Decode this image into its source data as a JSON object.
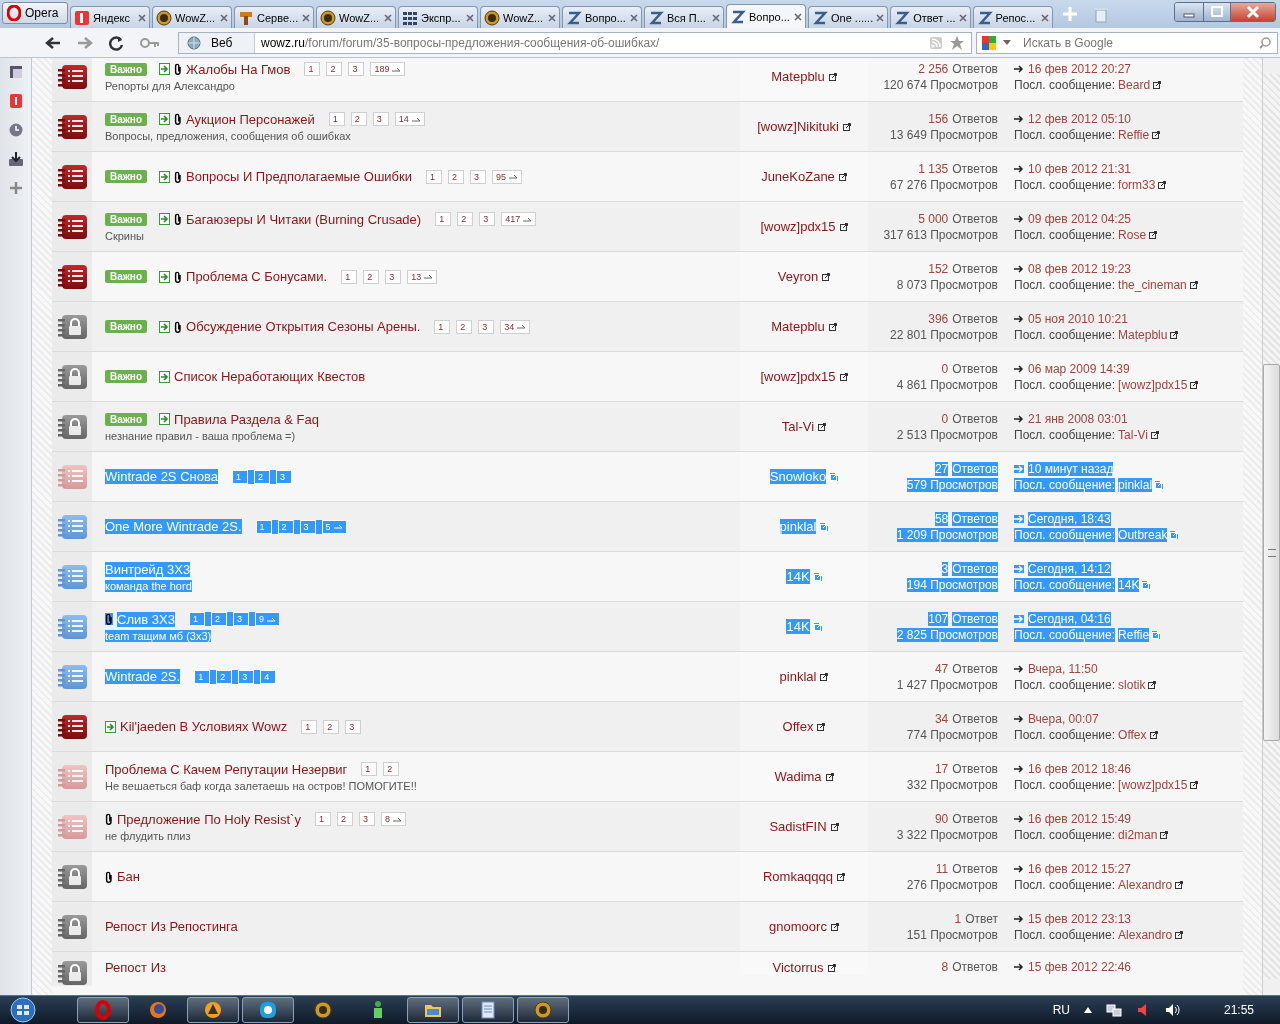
{
  "browser": {
    "menu_label": "Opera",
    "tabs": [
      {
        "title": "Яндекс",
        "kind": "square",
        "selected": false
      },
      {
        "title": "WowZ...",
        "kind": "coin",
        "selected": false
      },
      {
        "title": "Серве...",
        "kind": "hammer",
        "selected": false
      },
      {
        "title": "WowZ...",
        "kind": "coin",
        "selected": false
      },
      {
        "title": "Экспр...",
        "kind": "grid",
        "selected": false
      },
      {
        "title": "WowZ...",
        "kind": "coin",
        "selected": false
      },
      {
        "title": "Вопро...",
        "kind": "zigzag",
        "selected": false
      },
      {
        "title": "Вся П...",
        "kind": "zigzag",
        "selected": false
      },
      {
        "title": "Вопро...",
        "kind": "zigzag",
        "selected": true
      },
      {
        "title": "One ......",
        "kind": "zigzag",
        "selected": false
      },
      {
        "title": "Ответ ...",
        "kind": "zigzag",
        "selected": false
      },
      {
        "title": "Репос...",
        "kind": "zigzag",
        "selected": false
      }
    ],
    "address": {
      "scope": "Веб",
      "host": "wowz.ru",
      "path": "/forum/forum/35-вопросы-предложения-сообщения-об-ошибках/"
    },
    "search": {
      "placeholder": "Искать в Google"
    }
  },
  "topics": [
    {
      "kind": "hot",
      "badge": "Важно",
      "new": true,
      "attachment": true,
      "title": "Жалобы На Гмов",
      "subtitle": "Репорты для Александро",
      "pages": [
        "1",
        "2",
        "3"
      ],
      "last_page": "189",
      "author": "Matepblu",
      "replies": "2 256",
      "replies_word": "Ответов",
      "views": "120 674 Просмотров",
      "last_time": "16 фев 2012 20:27",
      "last_label": "Посл. сообщение:",
      "last_by": "Beard",
      "title_selected": false,
      "selected": false
    },
    {
      "kind": "hot",
      "badge": "Важно",
      "new": true,
      "attachment": true,
      "title": "Аукцион Персонажей",
      "subtitle": "Вопросы, предложения, сообщения об ошибках",
      "pages": [
        "1",
        "2",
        "3"
      ],
      "last_page": "14",
      "author": "[wowz]Nikituki",
      "replies": "156",
      "replies_word": "Ответов",
      "views": "13 649 Просмотров",
      "last_time": "12 фев 2012 05:10",
      "last_label": "Посл. сообщение:",
      "last_by": "Reffie",
      "title_selected": false,
      "selected": false
    },
    {
      "kind": "hot",
      "badge": "Важно",
      "new": true,
      "attachment": true,
      "title": "Вопросы И Предполагаемые Ошибки",
      "pages": [
        "1",
        "2",
        "3"
      ],
      "last_page": "95",
      "author": "JuneKoZane",
      "replies": "1 135",
      "replies_word": "Ответов",
      "views": "67 276 Просмотров",
      "last_time": "10 фев 2012 21:31",
      "last_label": "Посл. сообщение:",
      "last_by": "form33",
      "title_selected": false,
      "selected": false
    },
    {
      "kind": "hot",
      "badge": "Важно",
      "new": true,
      "attachment": true,
      "title": "Багаюзеры И Читаки (Burning Crusade)",
      "subtitle": "Скрины",
      "pages": [
        "1",
        "2",
        "3"
      ],
      "last_page": "417",
      "author": "[wowz]pdx15",
      "replies": "5 000",
      "replies_word": "Ответов",
      "views": "317 613 Просмотров",
      "last_time": "09 фев 2012 04:25",
      "last_label": "Посл. сообщение:",
      "last_by": "Rose",
      "title_selected": false,
      "selected": false
    },
    {
      "kind": "hot",
      "badge": "Важно",
      "new": true,
      "attachment": true,
      "title": "Проблема С Бонусами.",
      "pages": [
        "1",
        "2",
        "3"
      ],
      "last_page": "13",
      "author": "Veyron",
      "replies": "152",
      "replies_word": "Ответов",
      "views": "8 073 Просмотров",
      "last_time": "08 фев 2012 19:23",
      "last_label": "Посл. сообщение:",
      "last_by": "the_cineman",
      "title_selected": false,
      "selected": false
    },
    {
      "kind": "locked",
      "badge": "Важно",
      "new": true,
      "attachment": true,
      "title": "Обсуждение Открытия Сезоны Арены.",
      "pages": [
        "1",
        "2",
        "3"
      ],
      "last_page": "34",
      "author": "Matepblu",
      "replies": "396",
      "replies_word": "Ответов",
      "views": "22 801 Просмотров",
      "last_time": "05 ноя 2010 10:21",
      "last_label": "Посл. сообщение:",
      "last_by": "Matepblu",
      "title_selected": false,
      "selected": false
    },
    {
      "kind": "locked",
      "badge": "Важно",
      "new": true,
      "attachment": false,
      "title": "Список Неработающих Квестов",
      "author": "[wowz]pdx15",
      "replies": "0",
      "replies_word": "Ответов",
      "views": "4 861 Просмотров",
      "last_time": "06 мар 2009 14:39",
      "last_label": "Посл. сообщение:",
      "last_by": "[wowz]pdx15",
      "title_selected": false,
      "selected": false
    },
    {
      "kind": "locked",
      "badge": "Важно",
      "new": true,
      "attachment": false,
      "title": "Правила Раздела & Faq",
      "subtitle": "незнание правил - ваша проблема =)",
      "author": "Tal-Vi",
      "replies": "0",
      "replies_word": "Ответов",
      "views": "2 513 Просмотров",
      "last_time": "21 янв 2008 03:01",
      "last_label": "Посл. сообщение:",
      "last_by": "Tal-Vi",
      "title_selected": false,
      "selected": false
    },
    {
      "kind": "read",
      "new": false,
      "attachment": false,
      "title": "Wintrade 2S Снова",
      "pages": [
        "1",
        "2",
        "3"
      ],
      "author": "Snowloko",
      "replies": "27",
      "replies_word": "Ответов",
      "views": "579 Просмотров",
      "last_time": "10 минут назад",
      "last_label": "Посл. сообщение:",
      "last_by": "pinklal",
      "title_selected": true,
      "selected": true
    },
    {
      "kind": "highlighted",
      "new": false,
      "attachment": false,
      "title": "One More Wintrade 2S.",
      "pages": [
        "1",
        "2",
        "3"
      ],
      "last_page": "5",
      "author": "pinklal",
      "replies": "58",
      "replies_word": "Ответов",
      "views": "1 209 Просмотров",
      "last_time": "Сегодня, 18:43",
      "last_label": "Посл. сообщение:",
      "last_by": "Outbreak",
      "title_selected": true,
      "selected": true
    },
    {
      "kind": "highlighted",
      "new": false,
      "attachment": false,
      "title": "Винтрейд 3X3",
      "subtitle": "команда the hord",
      "author": "14K",
      "replies": "3",
      "replies_word": "Ответов",
      "views": "194 Просмотров",
      "last_time": "Сегодня, 14:12",
      "last_label": "Посл. сообщение:",
      "last_by": "14K",
      "title_selected": true,
      "selected": true
    },
    {
      "kind": "highlighted",
      "new": false,
      "attachment": true,
      "title": "Слив 3X3",
      "subtitle": "team тащим мб (3x3)",
      "pages": [
        "1",
        "2",
        "3"
      ],
      "last_page": "9",
      "author": "14K",
      "replies": "107",
      "replies_word": "Ответов",
      "views": "2 825 Просмотров",
      "last_time": "Сегодня, 04:16",
      "last_label": "Посл. сообщение:",
      "last_by": "Reffie",
      "title_selected": true,
      "selected": true
    },
    {
      "kind": "highlighted",
      "new": false,
      "attachment": false,
      "title": "Wintrade 2S.",
      "pages": [
        "1",
        "2",
        "3",
        "4"
      ],
      "author": "pinklal",
      "replies": "47",
      "replies_word": "Ответов",
      "views": "1 427 Просмотров",
      "last_time": "Вчера, 11:50",
      "last_label": "Посл. сообщение:",
      "last_by": "slotik",
      "title_selected": true,
      "selected": false
    },
    {
      "kind": "hot",
      "new": true,
      "attachment": false,
      "title": "Kil'jaeden В Условиях Wowz",
      "pages": [
        "1",
        "2",
        "3"
      ],
      "author": "Offex",
      "replies": "34",
      "replies_word": "Ответов",
      "views": "774 Просмотров",
      "last_time": "Вчера, 00:07",
      "last_label": "Посл. сообщение:",
      "last_by": "Offex",
      "title_selected": false,
      "selected": false
    },
    {
      "kind": "read",
      "new": false,
      "attachment": false,
      "title": "Проблема С Качем Репутации Незервиг",
      "subtitle": "Не вешаеться баф когда залетаешь на остров! ПОМОГИТЕ!!",
      "pages": [
        "1",
        "2"
      ],
      "author": "Wadima",
      "replies": "17",
      "replies_word": "Ответов",
      "views": "332 Просмотров",
      "last_time": "16 фев 2012 18:46",
      "last_label": "Посл. сообщение:",
      "last_by": "[wowz]pdx15",
      "title_selected": false,
      "selected": false
    },
    {
      "kind": "read",
      "new": false,
      "attachment": true,
      "title": "Предложение По Holy Resist`y",
      "subtitle": "не флудить плиз",
      "pages": [
        "1",
        "2",
        "3"
      ],
      "last_page": "8",
      "author": "SadistFIN",
      "replies": "90",
      "replies_word": "Ответов",
      "views": "3 322 Просмотров",
      "last_time": "16 фев 2012 15:49",
      "last_label": "Посл. сообщение:",
      "last_by": "di2man",
      "title_selected": false,
      "selected": false
    },
    {
      "kind": "locked",
      "new": false,
      "attachment": true,
      "title": "Бан",
      "author": "Romkaqqqq",
      "replies": "11",
      "replies_word": "Ответов",
      "views": "276 Просмотров",
      "last_time": "16 фев 2012 15:27",
      "last_label": "Посл. сообщение:",
      "last_by": "Alexandro",
      "title_selected": false,
      "selected": false
    },
    {
      "kind": "locked",
      "new": false,
      "attachment": false,
      "title": "Репост Из Репостинга",
      "author": "gnomoorc",
      "replies": "1",
      "replies_word": "Ответ",
      "views": "151 Просмотров",
      "last_time": "15 фев 2012 23:13",
      "last_label": "Посл. сообщение:",
      "last_by": "Alexandro",
      "title_selected": false,
      "selected": false
    },
    {
      "kind": "locked",
      "new": false,
      "attachment": false,
      "title": "Репост Из",
      "author": "Victorrus",
      "replies": "8",
      "replies_word": "Ответов",
      "last_time": "15 фев 2012 22:46",
      "title_selected": false,
      "selected": false
    }
  ],
  "taskbar": {
    "apps": [
      {
        "kind": "ring",
        "running": true
      },
      {
        "kind": "globe",
        "running": false
      },
      {
        "kind": "triangle",
        "running": true
      },
      {
        "kind": "chat",
        "running": true
      },
      {
        "kind": "coin",
        "running": false
      },
      {
        "kind": "figure",
        "running": false
      },
      {
        "kind": "folder",
        "running": true
      },
      {
        "kind": "notepad",
        "running": true
      },
      {
        "kind": "coin",
        "running": true
      }
    ],
    "language": "RU",
    "clock": "21:55"
  }
}
